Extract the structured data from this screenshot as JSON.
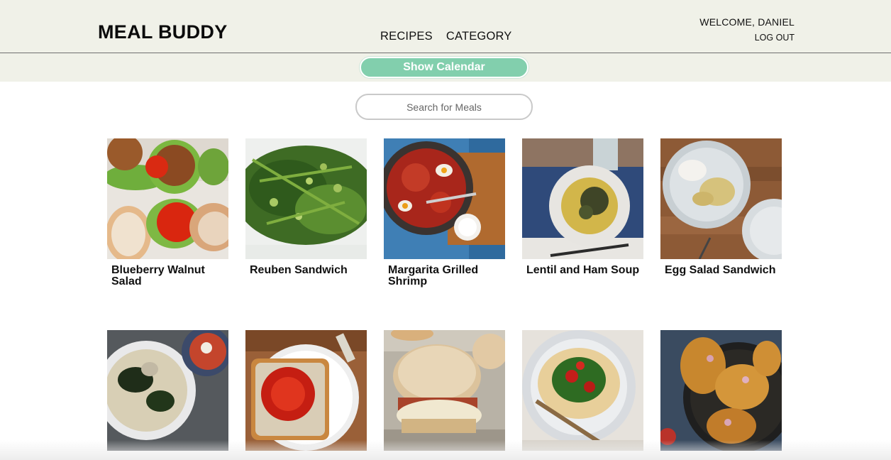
{
  "app": {
    "logo": "MEAL BUDDY"
  },
  "nav": {
    "recipes": "RECIPES",
    "category": "CATEGORY"
  },
  "user": {
    "welcome": "WELCOME, DANIEL",
    "logout": "LOG OUT"
  },
  "calendar_button": "Show Calendar",
  "search": {
    "placeholder": "Search for Meals",
    "value": ""
  },
  "recipes": [
    {
      "title": "Blueberry Walnut Salad",
      "image": "veggie-burgers-photo"
    },
    {
      "title": "Reuben Sandwich",
      "image": "green-bean-salad-photo"
    },
    {
      "title": "Margarita Grilled Shrimp",
      "image": "shakshuka-skillet-photo"
    },
    {
      "title": "Lentil and Ham Soup",
      "image": "lentil-bowl-photo"
    },
    {
      "title": "Egg Salad Sandwich",
      "image": "tortellini-plate-photo"
    },
    {
      "title": "",
      "image": "spaghetti-greens-photo"
    },
    {
      "title": "",
      "image": "tomato-toast-photo"
    },
    {
      "title": "",
      "image": "biscuit-sandwich-photo"
    },
    {
      "title": "",
      "image": "flatbread-salad-photo"
    },
    {
      "title": "",
      "image": "roast-chicken-pan-photo"
    }
  ]
}
